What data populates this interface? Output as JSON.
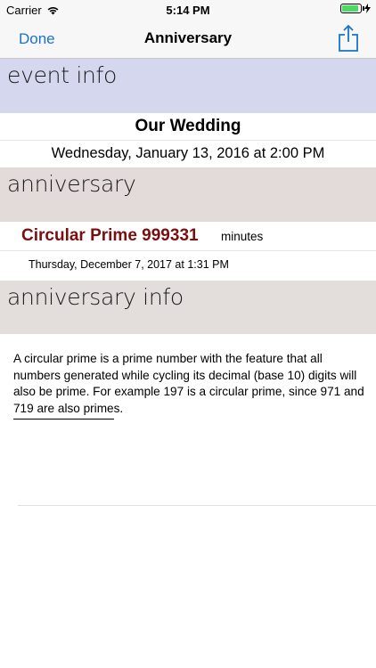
{
  "status_bar": {
    "carrier": "Carrier",
    "time": "5:14 PM",
    "battery_level": 0.9
  },
  "nav": {
    "done_label": "Done",
    "title": "Anniversary",
    "share_icon": "share-icon"
  },
  "event_info": {
    "header": "event info",
    "title": "Our Wedding",
    "date": "Wednesday, January 13, 2016 at 2:00 PM"
  },
  "anniversary": {
    "header": "anniversary",
    "name": "Circular Prime 999331",
    "unit": "minutes",
    "date": "Thursday, December 7, 2017 at 1:31 PM"
  },
  "anniversary_info": {
    "header": "anniversary info",
    "text": "A circular prime is a prime number with the feature that all numbers generated while cycling its decimal (base 10) digits will also be prime. For example 197 is a circular prime, since 971 and 719 are also primes."
  },
  "colors": {
    "accent": "#1a73c9",
    "anniversary_name": "#7a0f0f",
    "event_header_bg": "#d4d7ed",
    "anniversary_header_bg": "#e3dada",
    "info_header_bg": "#e3dedc"
  }
}
